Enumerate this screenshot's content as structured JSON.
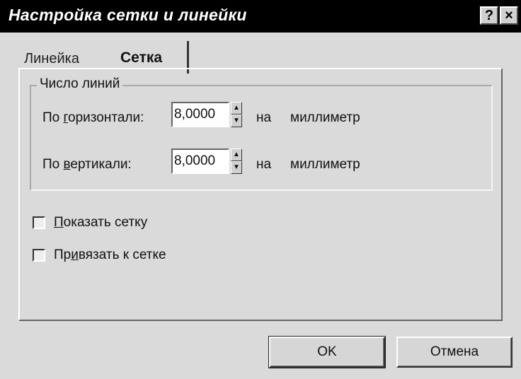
{
  "window": {
    "title": "Настройка сетки и линейки",
    "help_symbol": "?",
    "close_symbol": "×"
  },
  "tabs": [
    {
      "label": "Линейка",
      "active": false
    },
    {
      "label": "Сетка",
      "active": true
    }
  ],
  "group": {
    "label": "Число линий",
    "rows": [
      {
        "label_prefix": "По ",
        "label_underlined": "г",
        "label_rest": "оризонтали:",
        "value": "8,0000",
        "per": "на",
        "unit": "миллиметр"
      },
      {
        "label_prefix": "По ",
        "label_underlined": "в",
        "label_rest": "ертикали:",
        "value": "8,0000",
        "per": "на",
        "unit": "миллиметр"
      }
    ]
  },
  "checkboxes": [
    {
      "label_underlined": "П",
      "label_rest": "оказать сетку",
      "checked": false
    },
    {
      "label_prefix": "Пр",
      "label_underlined": "и",
      "label_rest": "вязать к сетке",
      "checked": false
    }
  ],
  "buttons": {
    "ok_label": "OK",
    "cancel_label": "Отмена"
  }
}
